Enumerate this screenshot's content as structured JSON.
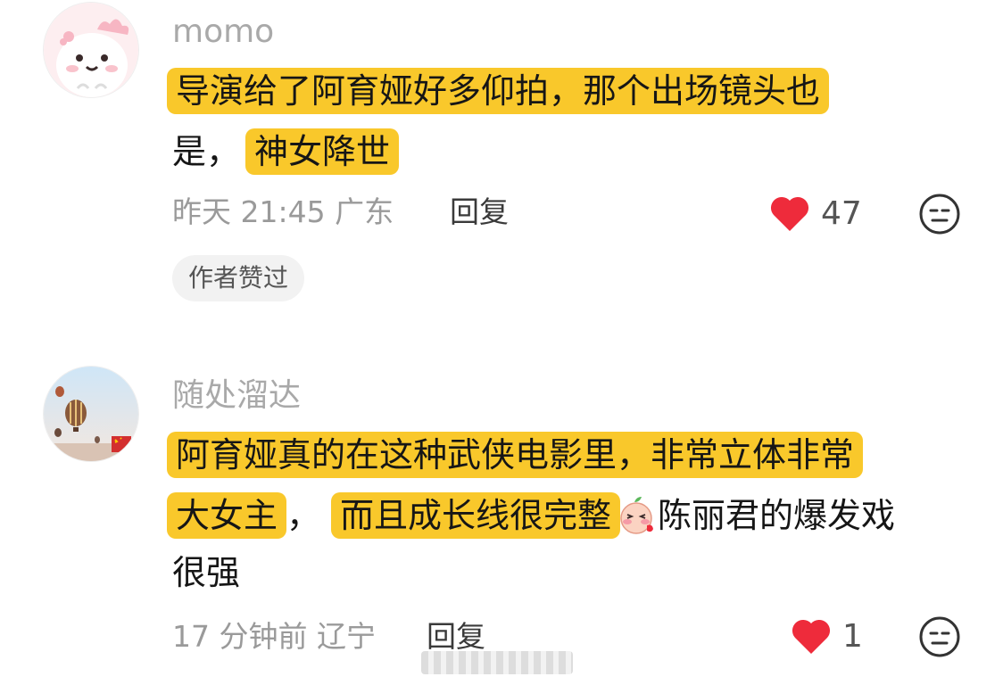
{
  "comments": [
    {
      "username": "momo",
      "line1": "导演给了阿育娅好多仰拍，那个出场镜头也",
      "line2_plain": "是，",
      "line2_highlight": "神女降世",
      "time": "昨天 21:45",
      "location": "广东",
      "reply": "回复",
      "likes": "47",
      "badge": "作者赞过"
    },
    {
      "username": "随处溜达",
      "line1": "阿育娅真的在这种武侠电影里，非常立体非常",
      "line2_hl_a": "大女主",
      "line2_plain": "，",
      "line2_hl_b": "而且成长线很完整",
      "line2_after": "陈丽君的爆发戏",
      "line3": "很强",
      "time": "17 分钟前",
      "location": "辽宁",
      "reply": "回复",
      "likes": "1"
    }
  ],
  "colors": {
    "highlight": "#f9c82b",
    "heart": "#ee2b3b",
    "username": "#a9a9a9",
    "meta": "#9a9a9a"
  },
  "icons": {
    "like": "heart-icon",
    "dislike": "neutral-face-icon",
    "inline_emoji": "blushing-peach-emoji"
  }
}
